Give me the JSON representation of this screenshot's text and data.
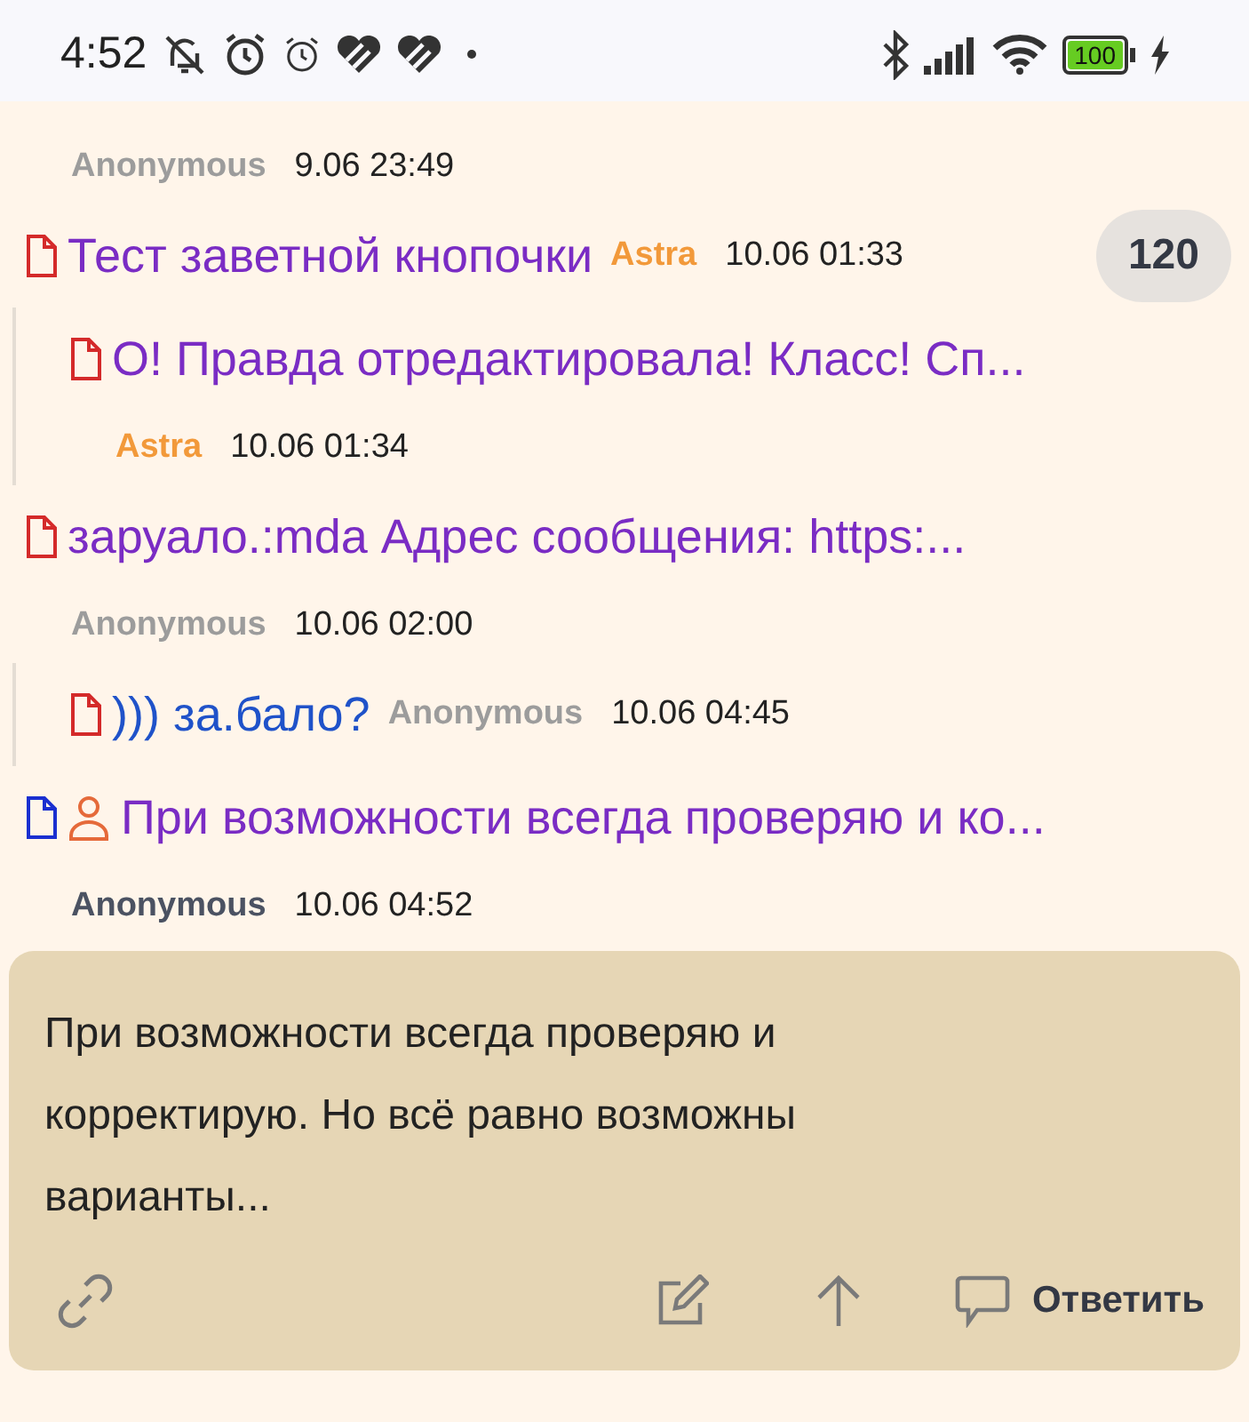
{
  "status_bar": {
    "time": "4:52",
    "battery": "100"
  },
  "posts": [
    {
      "kind": "meta",
      "author": "Anonymous",
      "registered": false,
      "current_user": false,
      "time": "9.06 23:49"
    },
    {
      "kind": "thread",
      "color": "#d42a2a",
      "own": false,
      "title": "Тест заветной кнопочки",
      "visited": true,
      "author": "Astra",
      "registered": true,
      "current_user": false,
      "time": "10.06 01:33",
      "meta_inline": true,
      "count": "120"
    },
    {
      "kind": "reply",
      "color": "#d42a2a",
      "own": false,
      "title": "О! Правда отредактировала! Класс! Сп...",
      "visited": true,
      "author": "Astra",
      "registered": true,
      "current_user": false,
      "time": "10.06 01:34",
      "meta_inline": false
    },
    {
      "kind": "thread",
      "color": "#d42a2a",
      "own": false,
      "title": "заруало.:mda Адрес сообщения: https:...",
      "visited": true,
      "author": "Anonymous",
      "registered": false,
      "current_user": false,
      "time": "10.06 02:00",
      "meta_inline": false
    },
    {
      "kind": "reply",
      "color": "#d42a2a",
      "own": false,
      "title": "))) за.бало?",
      "visited": false,
      "author": "Anonymous",
      "registered": false,
      "current_user": false,
      "time": "10.06 04:45",
      "meta_inline": true
    },
    {
      "kind": "thread",
      "color": "#1a2fd0",
      "own": true,
      "title": "При возможности всегда проверяю и ко...",
      "visited": true,
      "author": "Anonymous",
      "current_user": true,
      "time": "10.06 04:52",
      "meta_inline": false
    }
  ],
  "message": {
    "text": "При возможности всегда проверяю и корректирую. Но всё равно возможны варианты...",
    "reply_label": "Ответить"
  }
}
